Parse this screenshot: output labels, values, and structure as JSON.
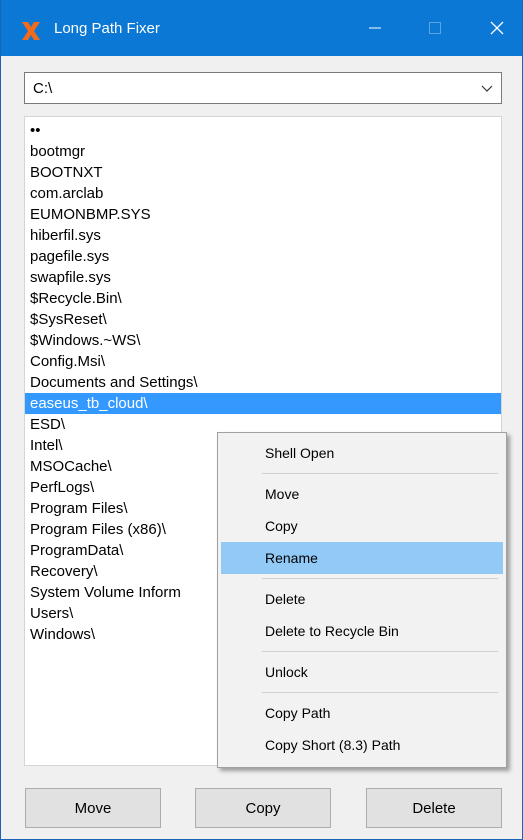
{
  "window": {
    "title": "Long Path Fixer"
  },
  "path_combo": {
    "value": "C:\\"
  },
  "files": [
    {
      "name": "••"
    },
    {
      "name": "bootmgr"
    },
    {
      "name": "BOOTNXT"
    },
    {
      "name": "com.arclab"
    },
    {
      "name": "EUMONBMP.SYS"
    },
    {
      "name": "hiberfil.sys"
    },
    {
      "name": "pagefile.sys"
    },
    {
      "name": "swapfile.sys"
    },
    {
      "name": "$Recycle.Bin\\"
    },
    {
      "name": "$SysReset\\"
    },
    {
      "name": "$Windows.~WS\\"
    },
    {
      "name": "Config.Msi\\"
    },
    {
      "name": "Documents and Settings\\"
    },
    {
      "name": "easeus_tb_cloud\\",
      "selected": true
    },
    {
      "name": "ESD\\"
    },
    {
      "name": "Intel\\"
    },
    {
      "name": "MSOCache\\"
    },
    {
      "name": "PerfLogs\\"
    },
    {
      "name": "Program Files\\"
    },
    {
      "name": "Program Files (x86)\\"
    },
    {
      "name": "ProgramData\\"
    },
    {
      "name": "Recovery\\"
    },
    {
      "name": "System Volume Inform"
    },
    {
      "name": "Users\\"
    },
    {
      "name": "Windows\\"
    }
  ],
  "context_menu": {
    "items": [
      {
        "label": "Shell Open"
      },
      {
        "separator": true
      },
      {
        "label": "Move"
      },
      {
        "label": "Copy"
      },
      {
        "label": "Rename",
        "highlighted": true
      },
      {
        "separator": true
      },
      {
        "label": "Delete"
      },
      {
        "label": "Delete to Recycle Bin"
      },
      {
        "separator": true
      },
      {
        "label": "Unlock"
      },
      {
        "separator": true
      },
      {
        "label": "Copy Path"
      },
      {
        "label": "Copy Short (8.3) Path"
      }
    ]
  },
  "buttons": {
    "move": "Move",
    "copy": "Copy",
    "delete": "Delete"
  },
  "colors": {
    "titlebar": "#0a78d4",
    "selection": "#3399ff",
    "menu_highlight": "#91c9f7",
    "app_icon": "#f26a1b"
  },
  "icons": {
    "app": "app-logo-icon",
    "minimize": "minimize-icon",
    "maximize": "maximize-icon",
    "close": "close-icon",
    "dropdown": "chevron-down-icon"
  }
}
